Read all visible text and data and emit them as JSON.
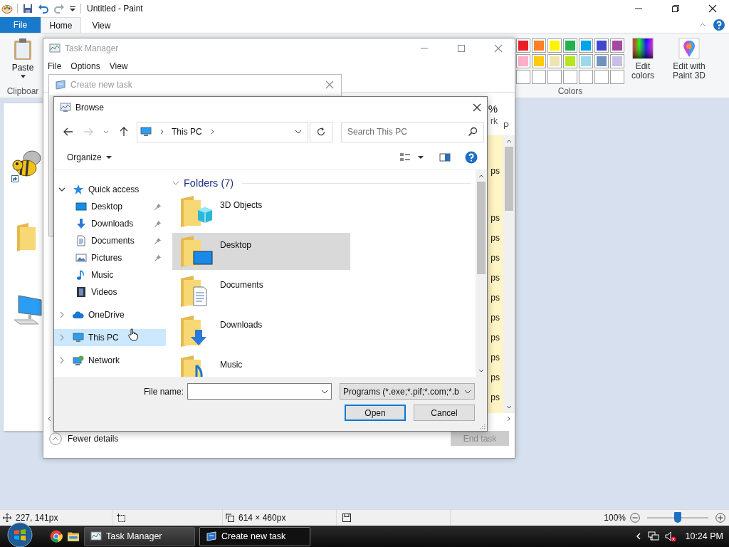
{
  "paint": {
    "title": "Untitled - Paint",
    "file_menu": "File",
    "tabs": [
      {
        "label": "Home",
        "selected": true
      },
      {
        "label": "View",
        "selected": false
      }
    ],
    "ribbon": {
      "paste": "Paste",
      "clipboard_group": "Clipboar",
      "colors": [
        {
          "color": "#ed1c24"
        },
        {
          "color": "#ff7f27"
        },
        {
          "color": "#fff200"
        },
        {
          "color": "#22b14c"
        },
        {
          "color": "#00a2e8"
        },
        {
          "color": "#3f48cc"
        },
        {
          "color": "#a349a4"
        },
        {
          "color": "#ffaec9"
        },
        {
          "color": "#ffc90e"
        },
        {
          "color": "#efe4b0"
        },
        {
          "color": "#b5e61d"
        },
        {
          "color": "#99d9ea"
        },
        {
          "color": "#7092be"
        },
        {
          "color": "#c8bfe7"
        },
        {
          "color": "#ffffff"
        },
        {
          "color": "#ffffff"
        },
        {
          "color": "#ffffff"
        },
        {
          "color": "#ffffff"
        },
        {
          "color": "#ffffff"
        },
        {
          "color": "#ffffff"
        },
        {
          "color": "#ffffff"
        }
      ],
      "edit_colors": "Edit colors",
      "edit_with_paint3d": "Edit with Paint 3D",
      "colors_group": "Colors"
    },
    "status_bar": {
      "cursor_position": "227, 141px",
      "canvas_size": "614 × 460px",
      "zoom": "100%",
      "zoom_slider": {
        "level": 0.5
      }
    }
  },
  "task_manager": {
    "title": "Task Manager",
    "active": false,
    "menu": [
      "File",
      "Options",
      "View"
    ],
    "columns": [
      {
        "top": "%",
        "name": "rk"
      },
      {
        "name": "P"
      }
    ],
    "cells": [
      "ps",
      "ps",
      "ps",
      "ps",
      "ps",
      "ps",
      "ps",
      "ps",
      "ps",
      "ps",
      "ps"
    ],
    "fewer_details": "Fewer details",
    "end_task": {
      "label": "End task",
      "disabled": true
    }
  },
  "create_new_task": {
    "title": "Create new task",
    "active": false
  },
  "browse": {
    "title": "Browse",
    "active": true,
    "address": "This PC",
    "search_placeholder": "Search This PC",
    "organize": "Organize",
    "nav": [
      {
        "label": "Quick access",
        "kind": "quick",
        "expanded": true,
        "selected": false,
        "children": [
          {
            "label": "Desktop",
            "kind": "desktop",
            "pinned": true,
            "selected": false
          },
          {
            "label": "Downloads",
            "kind": "downloads",
            "pinned": true,
            "selected": false
          },
          {
            "label": "Documents",
            "kind": "documents",
            "pinned": true,
            "selected": false
          },
          {
            "label": "Pictures",
            "kind": "pictures",
            "pinned": true,
            "selected": false
          },
          {
            "label": "Music",
            "kind": "music",
            "pinned": false,
            "selected": false
          },
          {
            "label": "Videos",
            "kind": "videos",
            "pinned": false,
            "selected": false
          }
        ]
      },
      {
        "label": "OneDrive",
        "kind": "onedrive",
        "expanded": false,
        "selected": false
      },
      {
        "label": "This PC",
        "kind": "pc",
        "expanded": false,
        "selected": true
      },
      {
        "label": "Network",
        "kind": "network",
        "expanded": false,
        "selected": false
      }
    ],
    "group": {
      "label": "Folders (7)",
      "expanded": true
    },
    "folders": [
      {
        "name": "3D Objects",
        "kind": "cube",
        "selected": false
      },
      {
        "name": "Desktop",
        "kind": "desktop",
        "selected": true
      },
      {
        "name": "Documents",
        "kind": "documents",
        "selected": false
      },
      {
        "name": "Downloads",
        "kind": "downloads",
        "selected": false
      },
      {
        "name": "Music",
        "kind": "music",
        "selected": false
      }
    ],
    "file_name_label": "File name:",
    "filter": "Programs (*.exe;*.pif;*.com;*.b",
    "buttons": [
      {
        "label": "Open",
        "default": true
      },
      {
        "label": "Cancel",
        "default": false
      }
    ]
  },
  "taskbar": {
    "apps": [
      {
        "label": "Task Manager",
        "kind": "taskmgr",
        "selected": false
      },
      {
        "label": "Create new task",
        "kind": "run",
        "selected": true
      }
    ],
    "clock": "10:24 PM"
  }
}
